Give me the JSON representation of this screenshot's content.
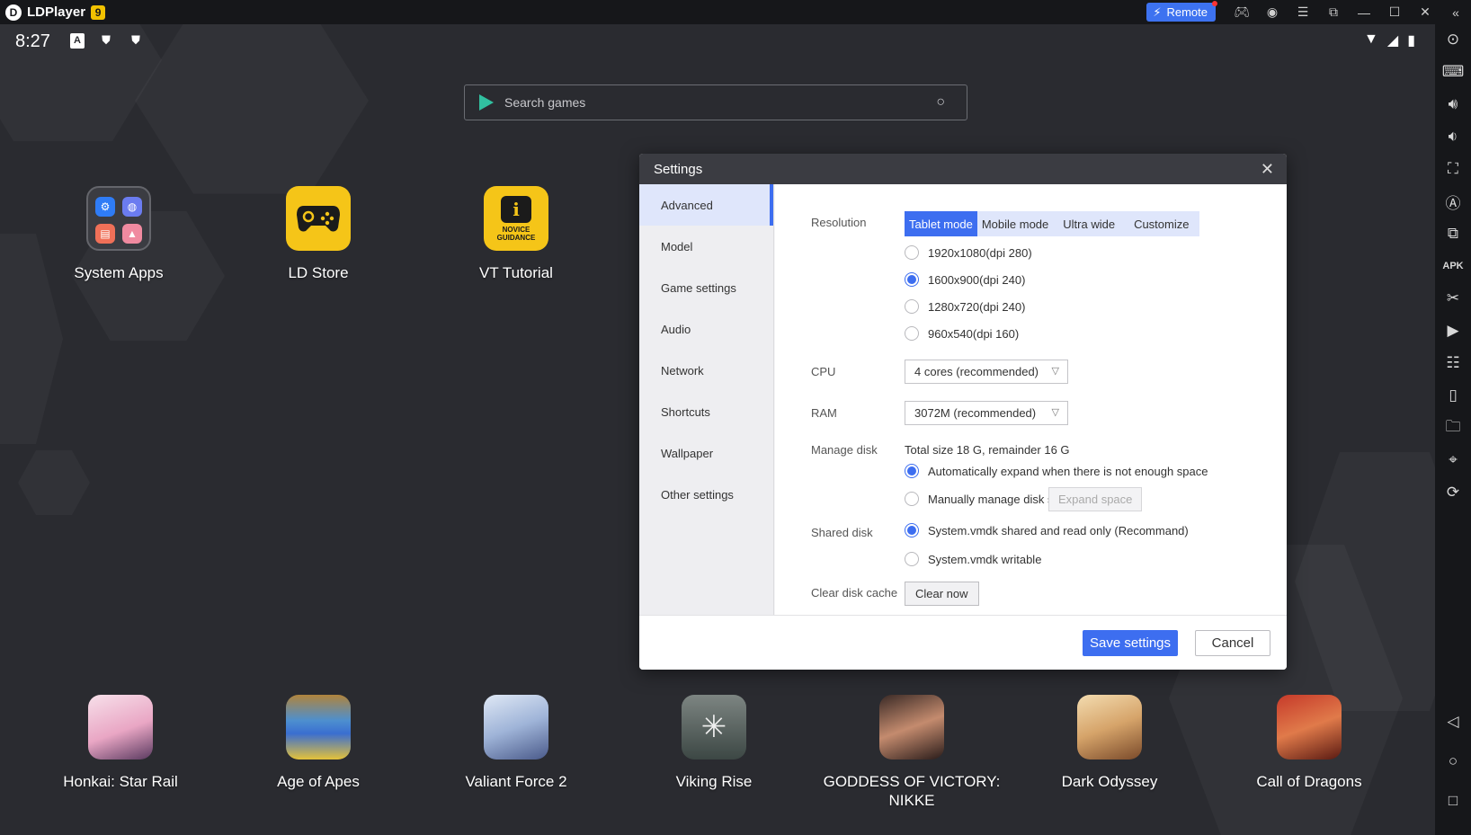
{
  "titlebar": {
    "app_name": "LDPlayer",
    "version_badge": "9",
    "remote_label": "Remote",
    "icons": [
      "gamepad-icon",
      "account-icon",
      "menu-icon",
      "restore-icon",
      "minimize-icon",
      "maximize-icon",
      "close-icon",
      "collapse-icon"
    ]
  },
  "statusbar": {
    "time": "8:27",
    "left_icons": [
      "a-notification-icon",
      "shield-icon",
      "shield-icon"
    ],
    "right_icons": [
      "wifi-icon",
      "signal-icon",
      "battery-icon"
    ]
  },
  "search": {
    "placeholder": "Search games"
  },
  "desktop_apps": [
    {
      "label": "System Apps"
    },
    {
      "label": "LD Store"
    },
    {
      "label": "VT Tutorial"
    }
  ],
  "dock_apps": [
    {
      "label": "Honkai: Star Rail"
    },
    {
      "label": "Age of Apes"
    },
    {
      "label": "Valiant Force 2"
    },
    {
      "label": "Viking Rise"
    },
    {
      "label": "GODDESS OF VICTORY: NIKKE"
    },
    {
      "label": "Dark Odyssey"
    },
    {
      "label": "Call of Dragons"
    }
  ],
  "tutorial_icon_text": "NOVICE GUIDANCE",
  "sidebar_icons": [
    "operation-record-icon",
    "keyboard-icon",
    "volume-up-icon",
    "volume-down-icon",
    "screenshot-icon",
    "sync-icon",
    "multi-instance-icon",
    "apk-icon",
    "scissors-icon",
    "video-icon",
    "operation-icon",
    "shake-icon",
    "folder-icon",
    "location-icon",
    "rotate-icon",
    "back-icon",
    "home-icon",
    "recents-icon"
  ],
  "settings": {
    "title": "Settings",
    "nav": [
      "Advanced",
      "Model",
      "Game settings",
      "Audio",
      "Network",
      "Shortcuts",
      "Wallpaper",
      "Other settings"
    ],
    "active_nav": "Advanced",
    "resolution": {
      "label": "Resolution",
      "modes": [
        "Tablet mode",
        "Mobile mode",
        "Ultra wide",
        "Customize"
      ],
      "active_mode": "Tablet mode",
      "options": [
        "1920x1080(dpi 280)",
        "1600x900(dpi 240)",
        "1280x720(dpi 240)",
        "960x540(dpi 160)"
      ],
      "selected": "1600x900(dpi 240)"
    },
    "cpu": {
      "label": "CPU",
      "value": "4 cores (recommended)"
    },
    "ram": {
      "label": "RAM",
      "value": "3072M (recommended)"
    },
    "manage_disk": {
      "label": "Manage disk",
      "info": "Total size 18 G, remainder 16 G",
      "auto": "Automatically expand when there is not enough space",
      "manual": "Manually manage disk size",
      "expand_button": "Expand space",
      "selected": "auto"
    },
    "shared_disk": {
      "label": "Shared disk",
      "shared": "System.vmdk shared and read only (Recommand)",
      "writable": "System.vmdk writable",
      "selected": "shared"
    },
    "clear_cache": {
      "label": "Clear disk cache",
      "button": "Clear now"
    },
    "save_label": "Save settings",
    "cancel_label": "Cancel"
  },
  "colors": {
    "accent": "#3d6ef0",
    "titlebar": "#16171a",
    "desktop": "#2a2b30",
    "dialog_header": "#3b3c42"
  }
}
